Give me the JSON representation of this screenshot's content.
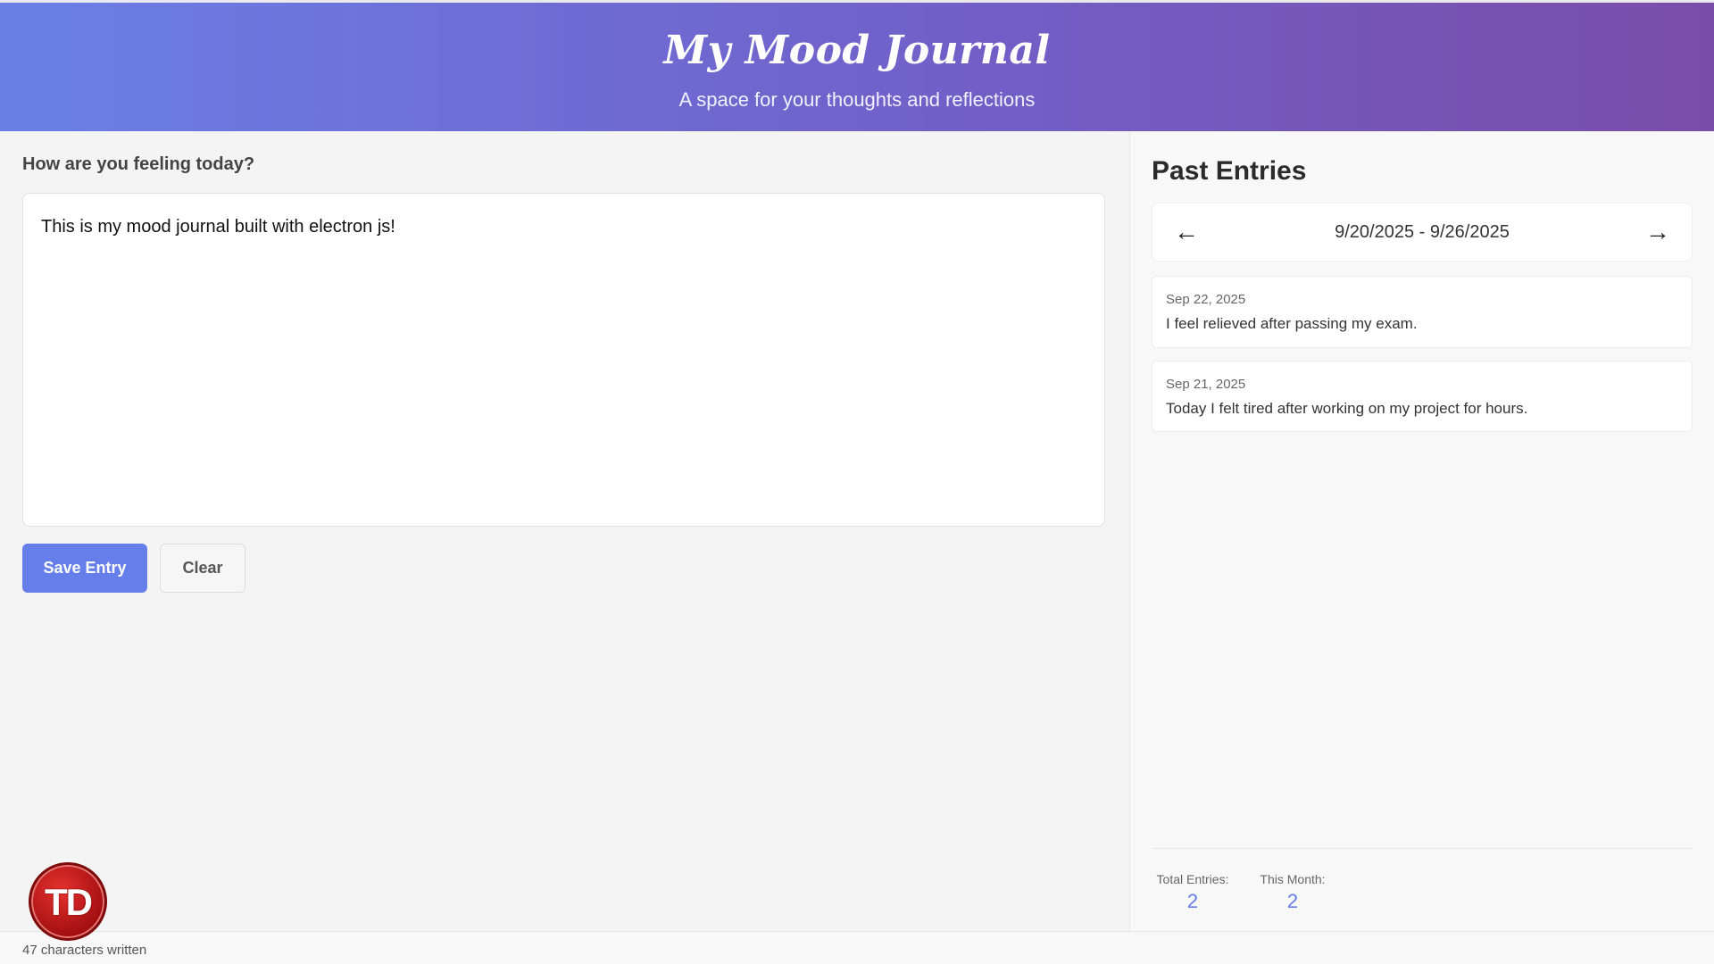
{
  "header": {
    "title": "My Mood Journal",
    "subtitle": "A space for your thoughts and reflections"
  },
  "editor": {
    "prompt": "How are you feeling today?",
    "value": "This is my mood journal built with electron js!",
    "save_label": "Save Entry",
    "clear_label": "Clear"
  },
  "logo": {
    "text": "TD"
  },
  "status": {
    "char_count": "47 characters written"
  },
  "sidebar": {
    "title": "Past Entries",
    "prev_arrow": "←",
    "next_arrow": "→",
    "range": "9/20/2025 - 9/26/2025",
    "entries": [
      {
        "date": "Sep 22, 2025",
        "text": "I feel relieved after passing my exam."
      },
      {
        "date": "Sep 21, 2025",
        "text": "Today I felt tired after working on my project for hours."
      }
    ],
    "stats": {
      "total_label": "Total Entries:",
      "total_value": "2",
      "month_label": "This Month:",
      "month_value": "2"
    }
  },
  "colors": {
    "accent": "#667eea",
    "header_gradient_start": "#6a7fe6",
    "header_gradient_end": "#7a4caa"
  }
}
